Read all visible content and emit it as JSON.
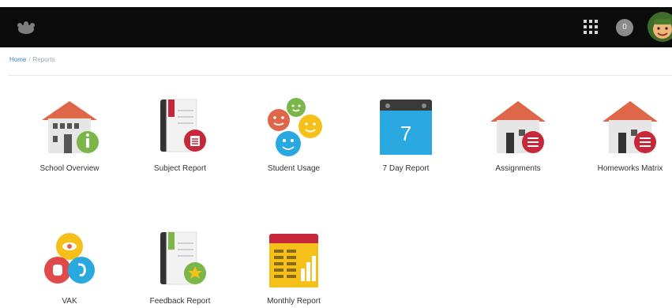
{
  "header": {
    "notification_count": "0",
    "logo_icon": "brand-logo-icon",
    "apps_icon": "apps-grid-icon",
    "avatar_icon": "user-avatar"
  },
  "breadcrumb": {
    "home": "Home",
    "separator": "/",
    "current": "Reports"
  },
  "reports": [
    {
      "label": "School Overview",
      "icon": "school-info-icon"
    },
    {
      "label": "Subject Report",
      "icon": "book-report-icon"
    },
    {
      "label": "Student Usage",
      "icon": "smiley-faces-icon"
    },
    {
      "label": "7 Day Report",
      "icon": "calendar-7-icon",
      "calendar_number": "7"
    },
    {
      "label": "Assignments",
      "icon": "house-list-icon"
    },
    {
      "label": "Homeworks Matrix",
      "icon": "house-matrix-icon"
    },
    {
      "label": "VAK",
      "icon": "vak-senses-icon"
    },
    {
      "label": "Feedback Report",
      "icon": "book-star-icon"
    },
    {
      "label": "Monthly Report",
      "icon": "monthly-calendar-chart-icon"
    }
  ],
  "colors": {
    "topbar": "#0b0b0b",
    "link": "#3a83c4",
    "roof": "#e0664a",
    "accent_red": "#c6283a",
    "accent_green": "#7ab648"
  }
}
